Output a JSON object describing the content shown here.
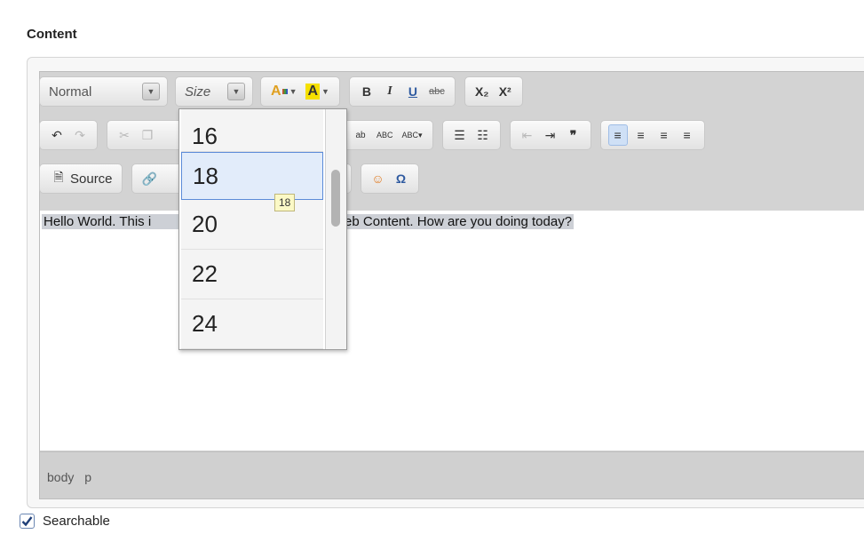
{
  "section_title": "Content",
  "toolbar": {
    "format_combo": "Normal",
    "size_combo": "Size",
    "text_color_icon": "text-color-icon",
    "bg_color_icon": "background-color-icon",
    "bold": "B",
    "italic": "I",
    "underline": "U",
    "strike": "abc",
    "subscript": "X₂",
    "superscript": "X²",
    "source_label": "Source"
  },
  "size_dropdown": {
    "items": [
      "16",
      "18",
      "20",
      "22",
      "24"
    ],
    "selected": "18",
    "tooltip": "18"
  },
  "editor": {
    "content_text_left": "Hello World. This i",
    "content_text_right": "Web Content. How are you doing today?"
  },
  "statusbar": {
    "path": [
      "body",
      "p"
    ]
  },
  "searchable": {
    "label": "Searchable",
    "checked": true
  },
  "colors": {
    "accent": "#5b8bd8",
    "selection": "#cdd0d6",
    "tooltip_bg": "#fbf9c6"
  }
}
